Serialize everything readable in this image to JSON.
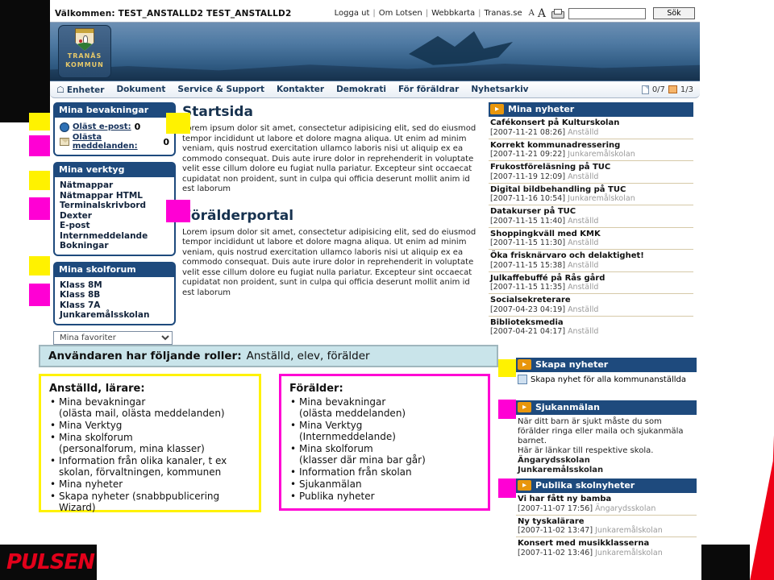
{
  "topbar": {
    "welcome": "Välkommen: TEST_ANSTALLD2 TEST_ANSTALLD2",
    "links": [
      "Logga ut",
      "Om Lotsen",
      "Webbkarta",
      "Tranas.se"
    ],
    "font_small": "A",
    "font_large": "A",
    "print_icon": "print-icon",
    "search_value": "",
    "search_placeholder": "",
    "search_button": "Sök"
  },
  "banner": {
    "logo_line1": "TRANÅS",
    "logo_line2": "KOMMUN"
  },
  "nav": {
    "home_icon": "home-icon",
    "items": [
      "Enheter",
      "Dokument",
      "Service & Support",
      "Kontakter",
      "Demokrati",
      "För föräldrar",
      "Nyhetsarkiv"
    ],
    "counter_docs": "0/7",
    "counter_mail": "1/3"
  },
  "left": {
    "watch_panel": {
      "title": "Mina bevakningar",
      "rows": [
        {
          "icon": "globe-icon",
          "label": "Oläst e-post:",
          "count": "0"
        },
        {
          "icon": "envelope-icon",
          "label": "Olästa meddelanden:",
          "count": "0"
        }
      ]
    },
    "tools_panel": {
      "title": "Mina verktyg",
      "items": [
        "Nätmappar",
        "Nätmappar HTML",
        "Terminalskrivbord",
        "Dexter",
        "E-post",
        "Internmeddelande",
        "Bokningar"
      ]
    },
    "forum_panel": {
      "title": "Mina skolforum",
      "items": [
        "Klass 8M",
        "Klass 8B",
        "Klass 7A",
        "Junkaremålsskolan"
      ]
    },
    "favorites_select": "Mina favoriter"
  },
  "main": {
    "blocks": [
      {
        "title": "Startsida",
        "text": "Lorem ipsum dolor sit amet, consectetur adipisicing elit, sed do eiusmod tempor incididunt ut labore et dolore magna aliqua. Ut enim ad minim veniam, quis nostrud exercitation ullamco laboris nisi ut aliquip ex ea commodo consequat. Duis aute irure dolor in reprehenderit in voluptate velit esse cillum dolore eu fugiat nulla pariatur. Excepteur sint occaecat cupidatat non proident, sunt in culpa qui officia deserunt mollit anim id est laborum"
      },
      {
        "title": "Förälderportal",
        "text": "Lorem ipsum dolor sit amet, consectetur adipisicing elit, sed do eiusmod tempor incididunt ut labore et dolore magna aliqua. Ut enim ad minim veniam, quis nostrud exercitation ullamco laboris nisi ut aliquip ex ea commodo consequat. Duis aute irure dolor in reprehenderit in voluptate velit esse cillum dolore eu fugiat nulla pariatur. Excepteur sint occaecat cupidatat non proident, sunt in culpa qui officia deserunt mollit anim id est laborum"
      }
    ]
  },
  "news_panel": {
    "title": "Mina nyheter",
    "items": [
      {
        "title": "Cafékonsert på Kulturskolan",
        "date": "[2007-11-21 08:26]",
        "source": "Anställd"
      },
      {
        "title": "Korrekt kommunadressering",
        "date": "[2007-11-21 09:22]",
        "source": "Junkaremålskolan"
      },
      {
        "title": "Frukostföreläsning på TUC",
        "date": "[2007-11-19 12:09]",
        "source": "Anställd"
      },
      {
        "title": "Digital bildbehandling på TUC",
        "date": "[2007-11-16 10:54]",
        "source": "Junkaremålskolan"
      },
      {
        "title": "Datakurser på TUC",
        "date": "[2007-11-15 11:40]",
        "source": "Anställd"
      },
      {
        "title": "Shoppingkväll med KMK",
        "date": "[2007-11-15 11:30]",
        "source": "Anställd"
      },
      {
        "title": "Öka frisknärvaro och delaktighet!",
        "date": "[2007-11-15 15:38]",
        "source": "Anställd"
      },
      {
        "title": "Julkaffebuffé på Rås gård",
        "date": "[2007-11-15 11:35]",
        "source": "Anställd"
      },
      {
        "title": "Socialsekreterare",
        "date": "[2007-04-23 04:19]",
        "source": "Anställd"
      },
      {
        "title": "Biblioteksmedia",
        "date": "[2007-04-21 04:17]",
        "source": "Anställd"
      }
    ]
  },
  "create_panel": {
    "title": "Skapa nyheter",
    "link": "Skapa nyhet för alla kommunanställda",
    "icon": "create-news-icon"
  },
  "sick_panel": {
    "title": "Sjukanmälan",
    "text_line1": "När ditt barn är sjukt måste du som",
    "text_line2": "förälder ringa eller maila och sjukanmäla",
    "text_line3": "barnet.",
    "text_line4": "Här är länkar till respektive skola.",
    "schools": [
      "Ängarydsskolan",
      "Junkaremålsskolan"
    ]
  },
  "public_news_panel": {
    "title": "Publika skolnyheter",
    "items": [
      {
        "title": "Vi har fått ny bamba",
        "date": "[2007-11-07 17:56]",
        "source": "Ängarydsskolan"
      },
      {
        "title": "Ny tyskalärare",
        "date": "[2007-11-02 13:47]",
        "source": "Junkaremålskolan"
      },
      {
        "title": "Konsert med musikklasserna",
        "date": "[2007-11-02 13:46]",
        "source": "Junkaremålskolan"
      }
    ]
  },
  "annotation": {
    "roles_label": "Användaren har följande roller:",
    "roles_value": "Anställd, elev, förälder",
    "employee_box": {
      "heading": "Anställd, lärare:",
      "items": [
        {
          "main": "Mina bevakningar",
          "sub": "(olästa mail, olästa meddelanden)"
        },
        {
          "main": "Mina Verktyg",
          "sub": ""
        },
        {
          "main": "Mina skolforum",
          "sub": "(personalforum, mina klasser)"
        },
        {
          "main": "Information från olika kanaler, t ex",
          "sub": "skolan, förvaltningen, kommunen"
        },
        {
          "main": "Mina nyheter",
          "sub": ""
        },
        {
          "main": "Skapa nyheter (snabbpublicering",
          "sub": "Wizard)"
        }
      ]
    },
    "parent_box": {
      "heading": "Förälder:",
      "items": [
        {
          "main": "Mina bevakningar",
          "sub": "(olästa meddelanden)"
        },
        {
          "main": "Mina Verktyg",
          "sub": "(Internmeddelande)"
        },
        {
          "main": "Mina skolforum",
          "sub": "(klasser där mina bar går)"
        },
        {
          "main": "Information från skolan",
          "sub": ""
        },
        {
          "main": "Sjukanmälan",
          "sub": ""
        },
        {
          "main": "Publika nyheter",
          "sub": ""
        }
      ]
    }
  },
  "branding": {
    "pulsen": "PULSEN"
  },
  "colors": {
    "panel_blue": "#1e4a7d",
    "mark_yellow": "#fff200",
    "mark_magenta": "#ff00d4",
    "roles_bar": "#c9e4ea",
    "swoosh_red": "#ee0016"
  }
}
